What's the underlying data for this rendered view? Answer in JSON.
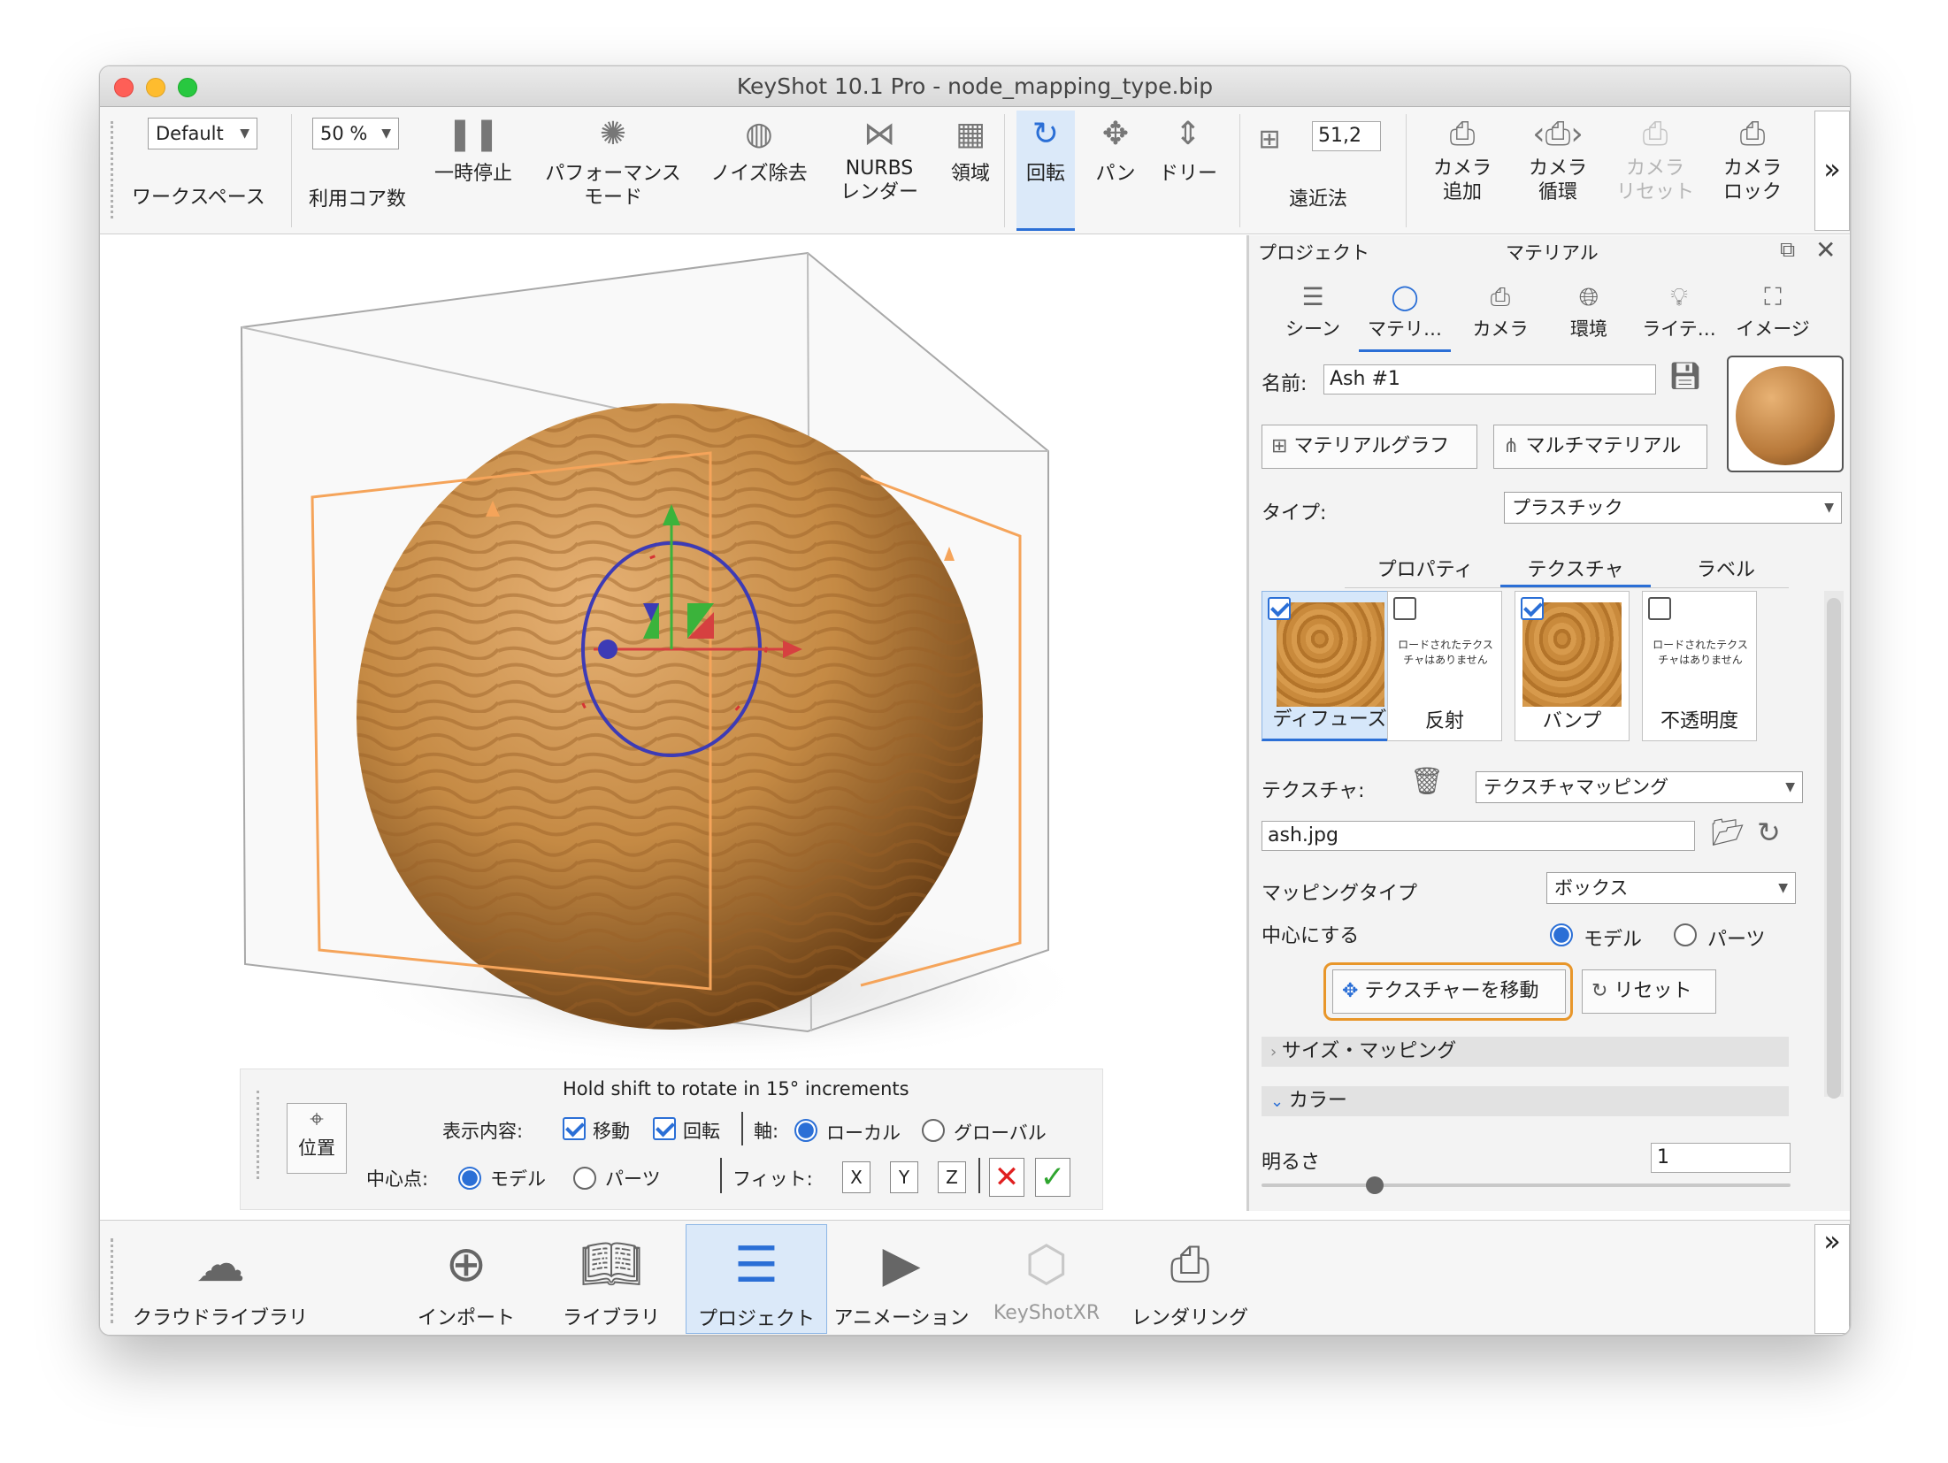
{
  "window": {
    "title": "KeyShot 10.1 Pro  - node_mapping_type.bip"
  },
  "toolbar": {
    "workspace_value": "Default",
    "workspace_label": "ワークスペース",
    "cores_value": "50 %",
    "cores_label": "利用コア数",
    "pause": "一時停止",
    "performance": "パフォーマンス\nモード",
    "denoise": "ノイズ除去",
    "nurbs": "NURBS\nレンダー",
    "region": "領域",
    "rotate": "回転",
    "pan": "パン",
    "dolly": "ドリー",
    "perspective_value": "51,2",
    "perspective": "遠近法",
    "add_camera": "カメラ\n追加",
    "cycle_camera": "カメラ\n循環",
    "reset_camera": "カメラ\nリセット",
    "lock_camera": "カメラ\nロック",
    "more": "»"
  },
  "viewport": {
    "hint": "Hold shift to rotate in 15° increments",
    "position_label": "位置",
    "display_label": "表示内容:",
    "move": "移動",
    "rotate": "回転",
    "axis_label": "軸:",
    "local": "ローカル",
    "global": "グローバル",
    "center_label": "中心点:",
    "model": "モデル",
    "parts": "パーツ",
    "fit_label": "フィット:",
    "x": "X",
    "y": "Y",
    "z": "Z"
  },
  "panel": {
    "header_project": "プロジェクト",
    "header_material": "マテリアル",
    "tabs": [
      {
        "label": "シーン",
        "icon": "scene-icon"
      },
      {
        "label": "マテリ…",
        "icon": "material-icon"
      },
      {
        "label": "カメラ",
        "icon": "camera-icon"
      },
      {
        "label": "環境",
        "icon": "globe-icon"
      },
      {
        "label": "ライテ…",
        "icon": "light-icon"
      },
      {
        "label": "イメージ",
        "icon": "image-icon"
      }
    ],
    "name_label": "名前:",
    "name_value": "Ash #1",
    "material_graph": "マテリアルグラフ",
    "multi_material": "マルチマテリアル",
    "type_label": "タイプ:",
    "type_value": "プラスチック",
    "subtabs": [
      "プロパティ",
      "テクスチャ",
      "ラベル"
    ],
    "textures": [
      {
        "label": "ディフューズ",
        "checked": true,
        "empty": ""
      },
      {
        "label": "反射",
        "checked": false,
        "empty": "ロードされたテクスチャはありません"
      },
      {
        "label": "バンプ",
        "checked": true,
        "empty": ""
      },
      {
        "label": "不透明度",
        "checked": false,
        "empty": "ロードされたテクスチャはありません"
      }
    ],
    "texture_label": "テクスチャ:",
    "texture_value": "テクスチャマッピング",
    "file_value": "ash.jpg",
    "mapping_label": "マッピングタイプ",
    "mapping_value": "ボックス",
    "center_label": "中心にする",
    "center_model": "モデル",
    "center_parts": "パーツ",
    "move_texture": "テクスチャーを移動",
    "reset": "リセット",
    "size_mapping": "サイズ・マッピング",
    "color": "カラー",
    "brightness_label": "明るさ",
    "brightness_value": "1"
  },
  "bottombar": {
    "items": [
      "クラウドライブラリ",
      "インポート",
      "ライブラリ",
      "プロジェクト",
      "アニメーション",
      "KeyShotXR",
      "レンダリング"
    ],
    "more": "»"
  },
  "colors": {
    "accent": "#2b6fd6",
    "highlight_orange": "#e8962a",
    "wood": "#c98a3c"
  }
}
